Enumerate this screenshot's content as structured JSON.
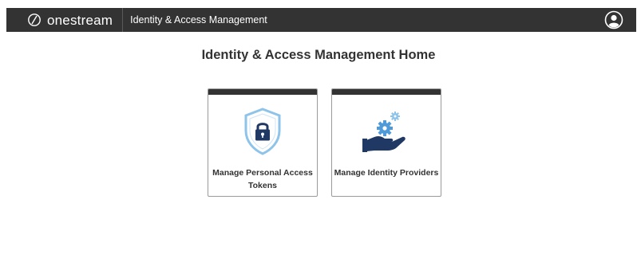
{
  "header": {
    "brand": "onestream",
    "app_title": "Identity & Access Management"
  },
  "main": {
    "title": "Identity & Access Management Home",
    "tiles": [
      {
        "label": "Manage Personal Access Tokens",
        "icon": "shield-lock-icon"
      },
      {
        "label": "Manage Identity Providers",
        "icon": "hand-gears-icon"
      }
    ]
  },
  "colors": {
    "header_bg": "#333333",
    "icon_navy": "#1f3864",
    "icon_light_blue": "#8ec3ea"
  }
}
